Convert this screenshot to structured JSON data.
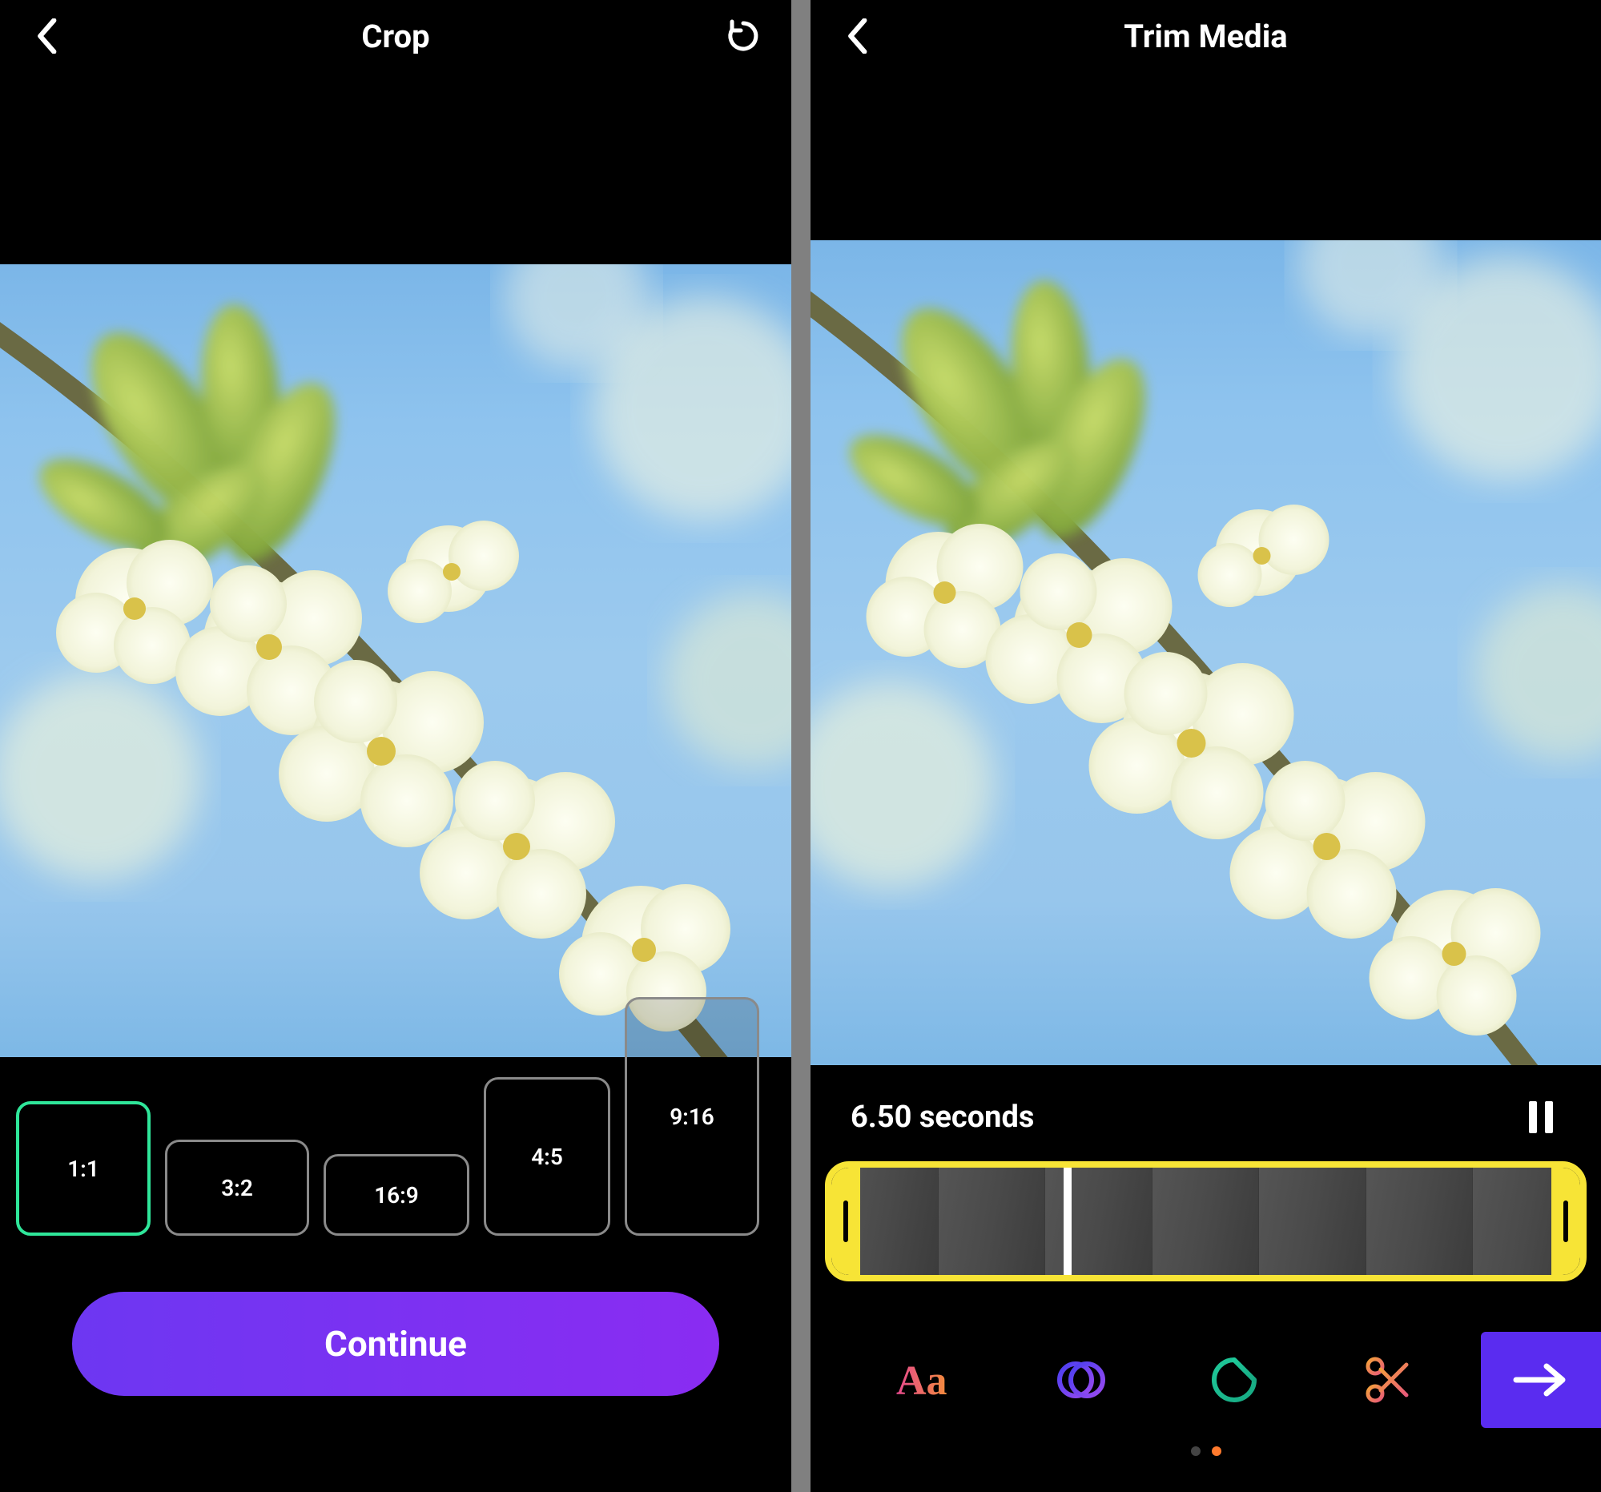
{
  "leftScreen": {
    "title": "Crop",
    "ratios": [
      {
        "label": "1:1",
        "selected": true
      },
      {
        "label": "3:2",
        "selected": false
      },
      {
        "label": "16:9",
        "selected": false
      },
      {
        "label": "4:5",
        "selected": false
      },
      {
        "label": "9:16",
        "selected": false
      }
    ],
    "continueLabel": "Continue"
  },
  "rightScreen": {
    "title": "Trim Media",
    "durationLabel": "6.50 seconds",
    "frameCount": 7,
    "playheadPercent": 31,
    "tools": [
      {
        "name": "text",
        "icon": "text-icon"
      },
      {
        "name": "filter",
        "icon": "filter-icon"
      },
      {
        "name": "sticker",
        "icon": "sticker-icon"
      },
      {
        "name": "trim",
        "icon": "scissors-icon"
      }
    ],
    "dots": {
      "count": 2,
      "activeIndex": 1
    }
  },
  "colors": {
    "accentGreen": "#2fe69a",
    "timelineYellow": "#f7e436",
    "purple": "#5a2cf0",
    "textPink": "#e84a8f",
    "textOrange": "#f28a3c",
    "filterBlue": "#4a3ff0",
    "filterPurple": "#9a4af0",
    "stickerTeal": "#1fc99a",
    "scissorsOrange": "#f48a3a",
    "scissorsPink": "#e85a7a"
  }
}
